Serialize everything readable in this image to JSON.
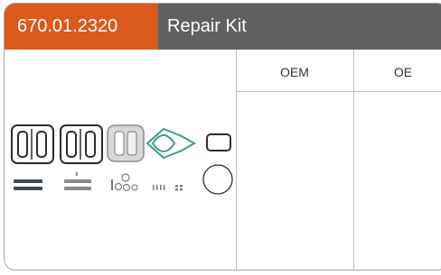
{
  "header": {
    "part_number": "670.01.2320",
    "title": "Repair Kit"
  },
  "columns": [
    {
      "label": "OEM"
    },
    {
      "label": "OE"
    }
  ],
  "product_image": {
    "icon": "repair-kit-parts-image"
  },
  "colors": {
    "accent": "#d95a1c",
    "header_bg": "#606060",
    "border": "#a9a9a9",
    "part_teal": "#3a9a8a"
  }
}
